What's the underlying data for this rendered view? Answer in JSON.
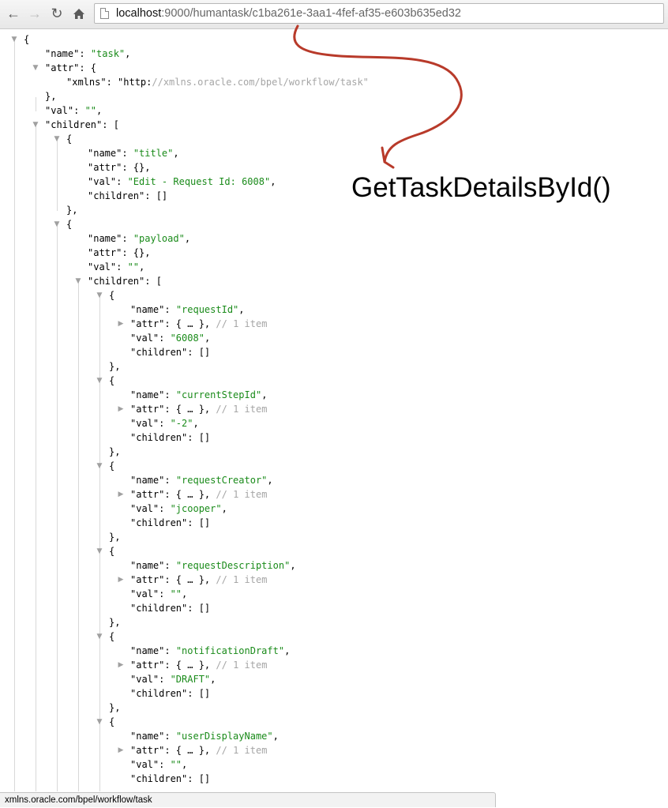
{
  "browser": {
    "url_host": "localhost",
    "url_rest": ":9000/humantask/c1ba261e-3aa1-4fef-af35-e603b635ed32",
    "back_icon": "arrow-left-icon",
    "forward_icon": "arrow-right-icon",
    "reload_icon": "reload-icon",
    "home_icon": "home-icon"
  },
  "json_view": {
    "lines": [
      "{",
      "\"name\": \"task\",",
      "\"attr\": {",
      "\"xmlns\": \"http://xmlns.oracle.com/bpel/workflow/task\"",
      "},",
      "\"val\": \"\",",
      "\"children\": [",
      "{",
      "\"name\": \"title\",",
      "\"attr\": {},",
      "\"val\": \"Edit - Request Id: 6008\",",
      "\"children\": []",
      "},",
      "{",
      "\"name\": \"payload\",",
      "\"attr\": {},",
      "\"val\": \"\",",
      "\"children\": [",
      "{",
      "\"name\": \"requestId\",",
      "\"attr\": { … }, // 1 item",
      "\"val\": \"6008\",",
      "\"children\": []",
      "},",
      "{",
      "\"name\": \"currentStepId\",",
      "\"attr\": { … }, // 1 item",
      "\"val\": \"-2\",",
      "\"children\": []",
      "},",
      "{",
      "\"name\": \"requestCreator\",",
      "\"attr\": { … }, // 1 item",
      "\"val\": \"jcooper\",",
      "\"children\": []",
      "},",
      "{",
      "\"name\": \"requestDescription\",",
      "\"attr\": { … }, // 1 item",
      "\"val\": \"\",",
      "\"children\": []",
      "},",
      "{",
      "\"name\": \"notificationDraft\",",
      "\"attr\": { … }, // 1 item",
      "\"val\": \"DRAFT\",",
      "\"children\": []",
      "},",
      "{",
      "\"name\": \"userDisplayName\",",
      "\"attr\": { … }, // 1 item",
      "\"val\": \"\",",
      "\"children\": []"
    ]
  },
  "annotation": {
    "text": "GetTaskDetailsById()",
    "color": "#b83a2a"
  },
  "status_bar": {
    "text": "xmlns.oracle.com/bpel/workflow/task"
  },
  "colors": {
    "string": "#1a8b1a",
    "comment": "#a6a6a6",
    "arrow": "#b83a2a"
  }
}
